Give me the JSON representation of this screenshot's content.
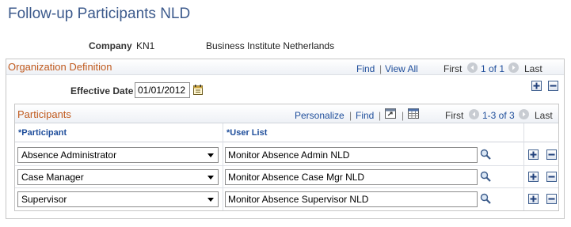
{
  "page": {
    "title": "Follow-up Participants NLD"
  },
  "header": {
    "company_label": "Company",
    "company_code": "KN1",
    "company_name": "Business Institute Netherlands"
  },
  "org_grid": {
    "title": "Organization Definition",
    "find": "Find",
    "separator": "|",
    "view_all": "View All",
    "first": "First",
    "count": "1 of 1",
    "last": "Last",
    "effective_date_label": "Effective Date",
    "effective_date_value": "01/01/2012"
  },
  "participants_grid": {
    "title": "Participants",
    "personalize": "Personalize",
    "separator": "|",
    "find": "Find",
    "first": "First",
    "count": "1-3 of 3",
    "last": "Last",
    "col_participant": "*Participant",
    "col_user_list": "*User List",
    "rows": [
      {
        "participant": "Absence Administrator",
        "user_list": "Monitor Absence Admin NLD"
      },
      {
        "participant": "Case Manager",
        "user_list": "Monitor Absence Case Mgr NLD"
      },
      {
        "participant": "Supervisor",
        "user_list": "Monitor Absence Supervisor NLD"
      }
    ]
  },
  "icons": {
    "nav_prev": "left-arrow-circle-icon",
    "nav_next": "right-arrow-circle-icon",
    "calendar": "calendar-icon",
    "lookup": "magnifier-icon",
    "add": "plus-icon",
    "remove": "minus-icon",
    "zoom": "zoom-grid-icon",
    "download": "spreadsheet-icon"
  },
  "colors": {
    "title": "#3c5a8c",
    "link": "#1f4e9b",
    "grid_title": "#c05a1e",
    "border": "#c6c6c6"
  }
}
